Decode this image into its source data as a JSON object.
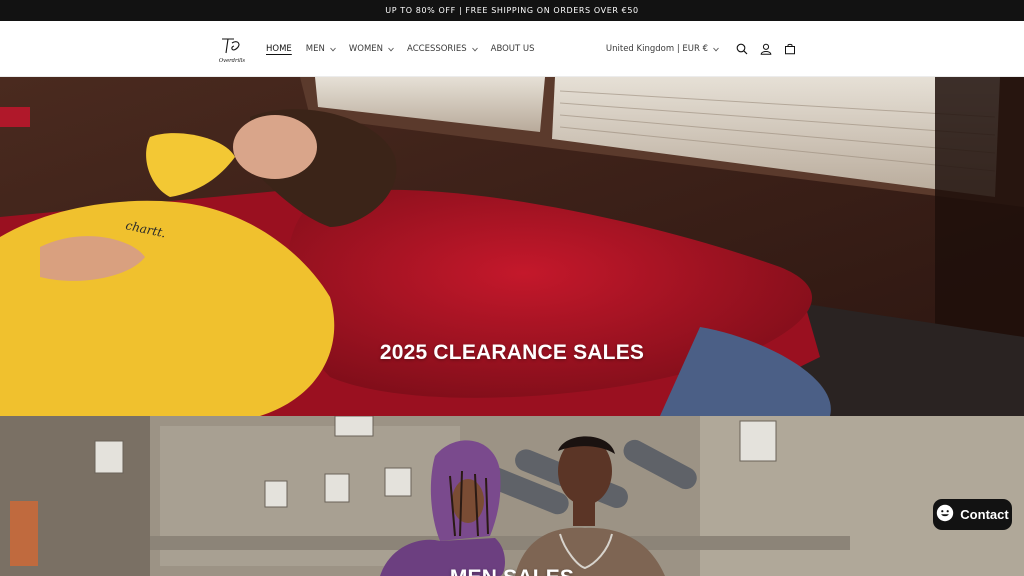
{
  "announcement": "UP TO 80% OFF | FREE SHIPPING ON ORDERS OVER €50",
  "logo_text": "Overdrills",
  "nav": [
    {
      "label": "HOME",
      "active": true,
      "dropdown": false
    },
    {
      "label": "MEN",
      "active": false,
      "dropdown": true
    },
    {
      "label": "WOMEN",
      "active": false,
      "dropdown": true
    },
    {
      "label": "ACCESSORIES",
      "active": false,
      "dropdown": true
    },
    {
      "label": "ABOUT US",
      "active": false,
      "dropdown": false
    }
  ],
  "country_selector": "United Kingdom | EUR €",
  "icons": [
    "search-icon",
    "account-icon",
    "cart-icon",
    "chevron-down-icon",
    "chat-icon"
  ],
  "hero": [
    {
      "title": "2025 CLEARANCE SALES"
    },
    {
      "title": "MEN SALES"
    }
  ],
  "contact_label": "Contact",
  "colors": {
    "announcement_bg": "#121212",
    "text": "#121212",
    "contact_bg": "#121212"
  }
}
